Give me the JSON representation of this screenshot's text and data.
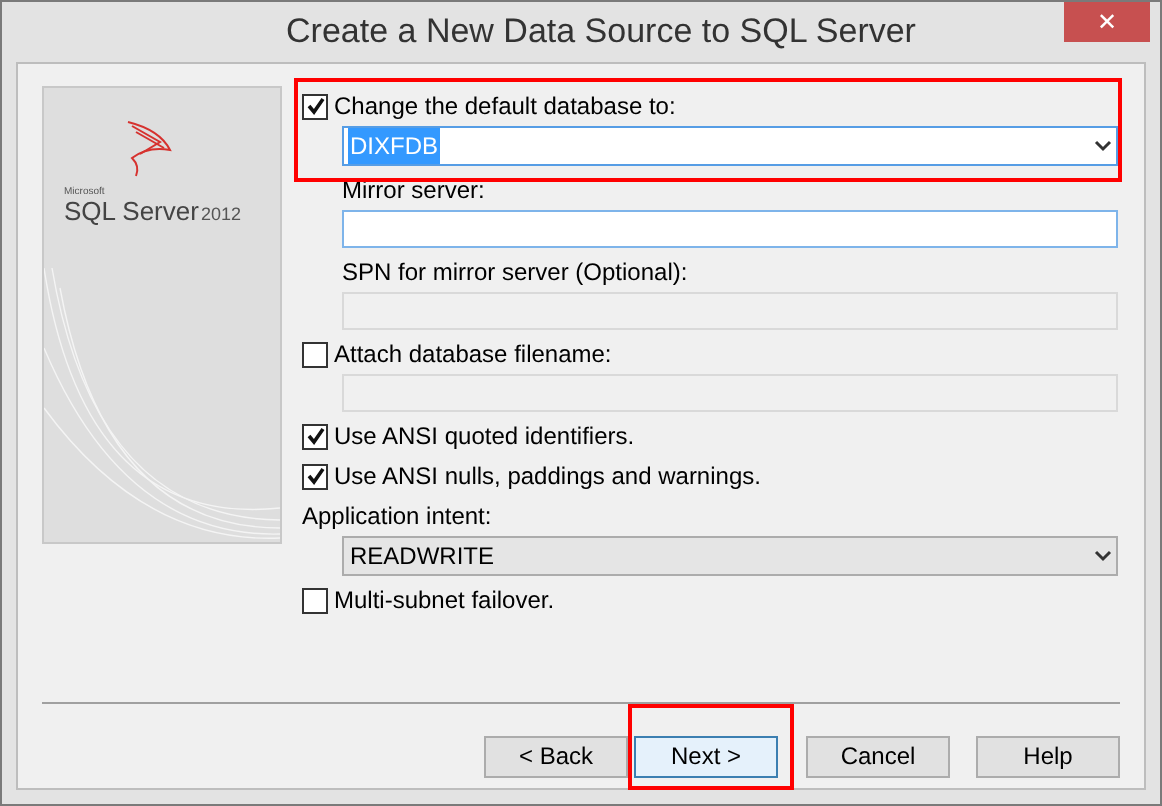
{
  "window": {
    "title": "Create a New Data Source to SQL Server",
    "close": "✕"
  },
  "logo": {
    "brand": "Microsoft",
    "product": "SQL Server",
    "version": "2012"
  },
  "fields": [
    {
      "kind": "checkbox",
      "label": "Change the default database to:",
      "checked": true,
      "highlighted": true
    },
    {
      "kind": "combo",
      "value": "DIXFDB",
      "focused": true,
      "highlighted": true
    },
    {
      "kind": "label",
      "label": "Mirror server:"
    },
    {
      "kind": "input",
      "disabled": false
    },
    {
      "kind": "label",
      "label": "SPN for mirror server (Optional):"
    },
    {
      "kind": "input",
      "disabled": true
    },
    {
      "kind": "checkbox",
      "label": "Attach database filename:",
      "checked": false
    },
    {
      "kind": "input",
      "disabled": true
    },
    {
      "kind": "checkbox",
      "label": "Use ANSI quoted identifiers.",
      "checked": true
    },
    {
      "kind": "checkbox",
      "label": "Use ANSI nulls, paddings and warnings.",
      "checked": true
    },
    {
      "kind": "plainlabel",
      "label": "Application intent:"
    },
    {
      "kind": "combo",
      "value": "READWRITE",
      "focused": false
    },
    {
      "kind": "checkbox",
      "label": "Multi-subnet failover.",
      "checked": false
    }
  ],
  "buttons": [
    {
      "label": "< Back",
      "focused": false,
      "highlighted": false
    },
    {
      "label": "Next >",
      "focused": true,
      "highlighted": true
    },
    {
      "label": "Cancel",
      "focused": false,
      "highlighted": false
    },
    {
      "label": "Help",
      "focused": false,
      "highlighted": false
    }
  ]
}
